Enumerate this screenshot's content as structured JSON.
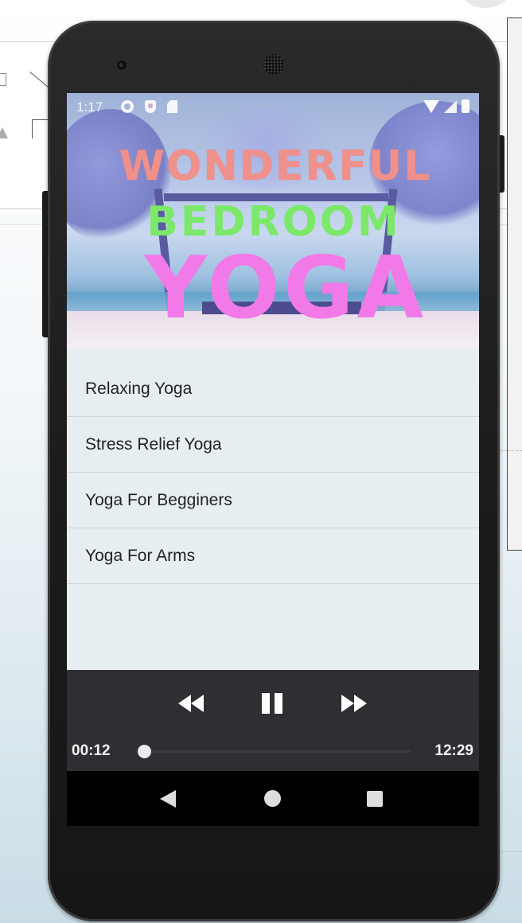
{
  "status_bar": {
    "time": "1:17",
    "left_icons": [
      "gear-icon",
      "shield-icon",
      "sd-card-icon"
    ],
    "right_icons": [
      "wifi-icon",
      "signal-icon",
      "battery-icon"
    ]
  },
  "banner": {
    "line1": "WONDERFUL",
    "line2": "BEDROOM",
    "line3": "YOGA",
    "colors": {
      "line1": "#f0908a",
      "line2": "#7be86a",
      "line3": "#f27ae8"
    }
  },
  "playlist": {
    "items": [
      {
        "label": "Relaxing Yoga"
      },
      {
        "label": "Stress Relief Yoga"
      },
      {
        "label": "Yoga For Begginers"
      },
      {
        "label": "Yoga For Arms"
      }
    ]
  },
  "player": {
    "current_time": "00:12",
    "total_time": "12:29",
    "progress": 0.016,
    "controls": [
      "rewind-icon",
      "pause-icon",
      "fast-forward-icon"
    ],
    "background_color": "#2e2e33"
  },
  "nav_bar": {
    "buttons": [
      "back-icon",
      "home-icon",
      "recents-icon"
    ]
  }
}
